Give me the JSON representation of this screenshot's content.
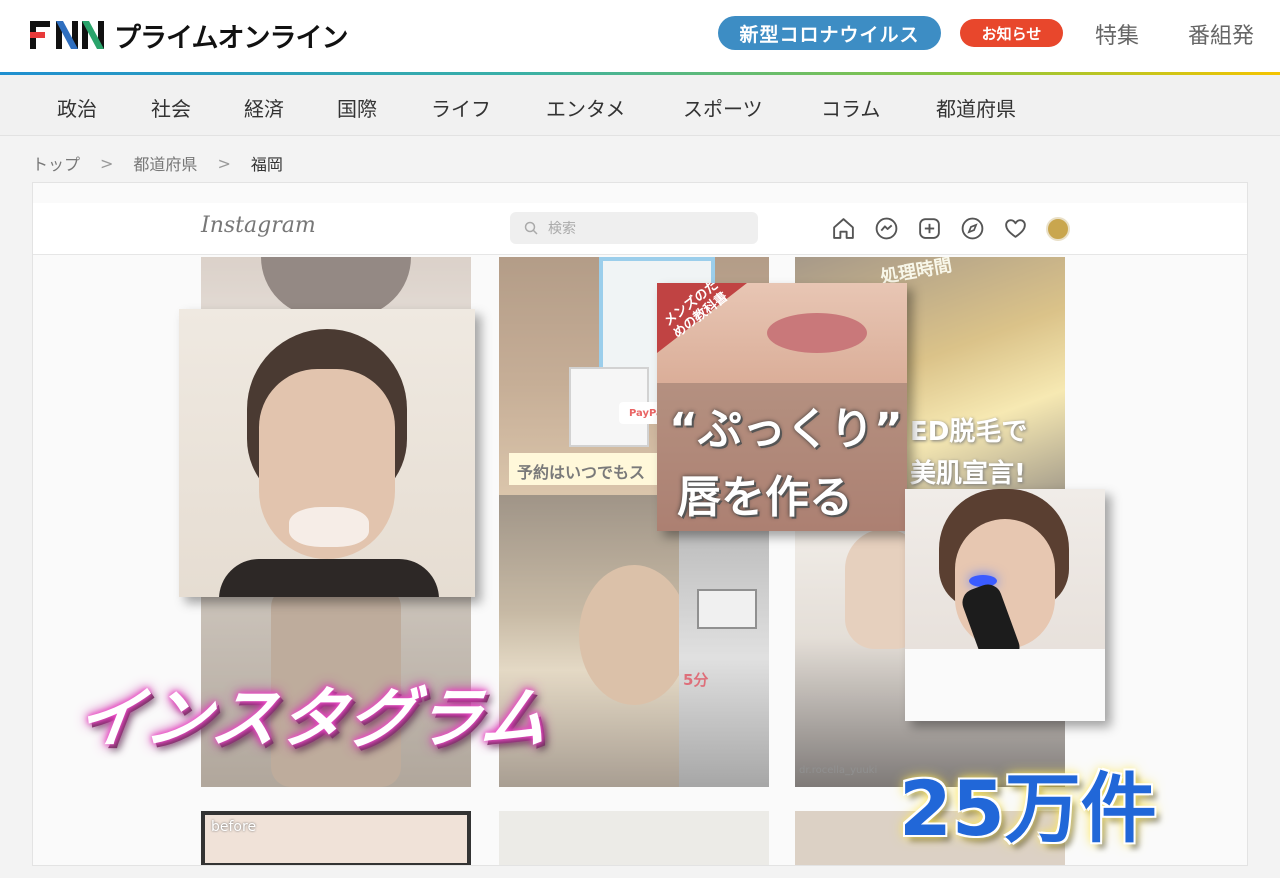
{
  "header": {
    "logo_fnn": "FNN",
    "logo_text": "プライムオンライン",
    "pill_corona": "新型コロナウイルス",
    "pill_notice": "お知らせ",
    "link_feature": "特集",
    "link_program": "番組発"
  },
  "nav": {
    "items": [
      "政治",
      "社会",
      "経済",
      "国際",
      "ライフ",
      "エンタメ",
      "スポーツ",
      "コラム",
      "都道府県"
    ]
  },
  "breadcrumb": {
    "items": [
      "トップ",
      "都道府県",
      "福岡"
    ],
    "separator": ">"
  },
  "image": {
    "ig_logo": "Instagram",
    "ig_search_placeholder": "検索",
    "tile_reserve": "予約はいつでもス",
    "tile_mens_book": "メンズのための教科書",
    "tile_puffy": "“ぷっくり”",
    "tile_lips": "唇を作る",
    "tile_datsumo": "ED脱毛で",
    "tile_bihada": "美肌宣言!",
    "tile_time": "処理時間",
    "tile_paypay": "PayPay",
    "tile_before": "before",
    "tile_user": "dr.rocella_yuuki",
    "tile_minutes": "5分",
    "caption_insta": "インスタグラム",
    "caption_count": "25万件"
  },
  "colors": {
    "accent_blue": "#3d8dc4",
    "accent_red": "#e8472c",
    "count_blue": "#2167d8"
  }
}
